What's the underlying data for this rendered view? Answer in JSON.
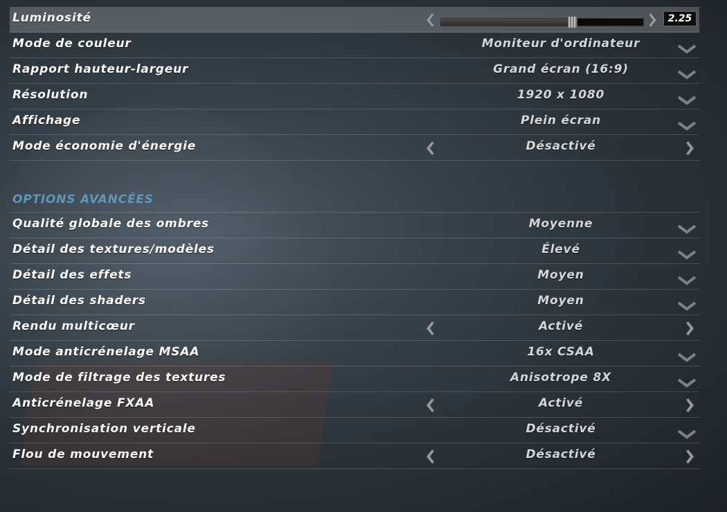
{
  "basic_settings": [
    {
      "label": "Luminosité",
      "control": "slider",
      "value": "2.25",
      "fraction": 0.65
    },
    {
      "label": "Mode de couleur",
      "control": "dropdown",
      "value": "Moniteur d'ordinateur"
    },
    {
      "label": "Rapport hauteur-largeur",
      "control": "dropdown",
      "value": "Grand écran (16:9)"
    },
    {
      "label": "Résolution",
      "control": "dropdown",
      "value": "1920 x 1080"
    },
    {
      "label": "Affichage",
      "control": "dropdown",
      "value": "Plein écran"
    },
    {
      "label": "Mode économie d'énergie",
      "control": "toggle",
      "value": "Désactivé"
    }
  ],
  "advanced": {
    "title": "OPTIONS AVANCÉES",
    "settings": [
      {
        "label": "Qualité globale des ombres",
        "control": "dropdown",
        "value": "Moyenne"
      },
      {
        "label": "Détail des textures/modèles",
        "control": "dropdown",
        "value": "Élevé"
      },
      {
        "label": "Détail des effets",
        "control": "dropdown",
        "value": "Moyen"
      },
      {
        "label": "Détail des shaders",
        "control": "dropdown",
        "value": "Moyen"
      },
      {
        "label": "Rendu multicœur",
        "control": "toggle",
        "value": "Activé"
      },
      {
        "label": "Mode anticrénelage MSAA",
        "control": "dropdown",
        "value": "16x CSAA"
      },
      {
        "label": "Mode de filtrage des textures",
        "control": "dropdown",
        "value": "Anisotrope 8X"
      },
      {
        "label": "Anticrénelage FXAA",
        "control": "toggle",
        "value": "Activé"
      },
      {
        "label": "Synchronisation verticale",
        "control": "dropdown",
        "value": "Désactivé"
      },
      {
        "label": "Flou de mouvement",
        "control": "toggle",
        "value": "Désactivé"
      }
    ]
  },
  "icons": {
    "left": "arrow-left-icon",
    "right": "arrow-right-icon",
    "dropdown": "chevron-down-icon"
  },
  "colors": {
    "section_title": "#5f97b8",
    "row_highlight": "#565c62",
    "label": "#ffffff",
    "value": "#d4d6d8"
  }
}
